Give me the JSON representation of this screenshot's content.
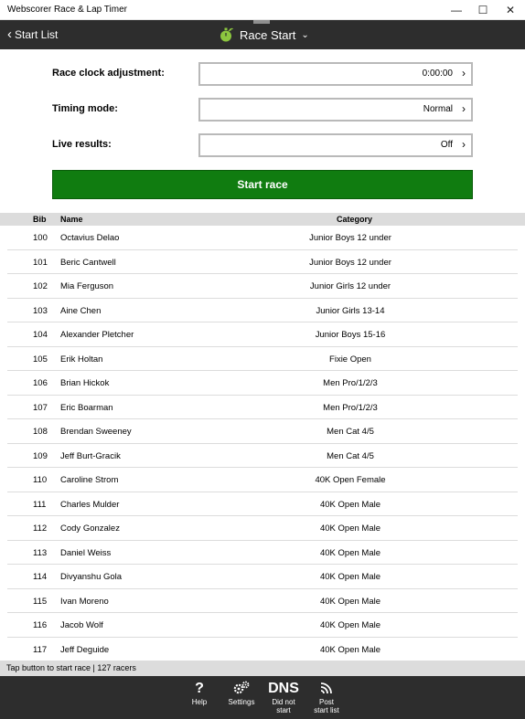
{
  "window": {
    "title": "Webscorer Race & Lap Timer",
    "minimize_glyph": "—",
    "maximize_glyph": "☐",
    "close_glyph": "✕"
  },
  "header": {
    "back_label": "Start List",
    "back_icon": "chevron-left-icon",
    "title": "Race Start",
    "logo_icon": "stopwatch-icon",
    "dropdown_icon": "chevron-down-icon"
  },
  "form": {
    "clock_label": "Race clock adjustment:",
    "clock_value": "0:00:00",
    "timing_label": "Timing mode:",
    "timing_value": "Normal",
    "live_label": "Live results:",
    "live_value": "Off"
  },
  "start_button": "Start race",
  "table": {
    "headers": {
      "bib": "Bib",
      "name": "Name",
      "category": "Category"
    },
    "rows": [
      {
        "bib": "100",
        "name": "Octavius Delao",
        "category": "Junior Boys 12 under"
      },
      {
        "bib": "101",
        "name": "Beric Cantwell",
        "category": "Junior Boys 12 under"
      },
      {
        "bib": "102",
        "name": "Mia Ferguson",
        "category": "Junior Girls 12 under"
      },
      {
        "bib": "103",
        "name": "Aine Chen",
        "category": "Junior Girls 13-14"
      },
      {
        "bib": "104",
        "name": "Alexander Pletcher",
        "category": "Junior Boys 15-16"
      },
      {
        "bib": "105",
        "name": "Erik Holtan",
        "category": "Fixie Open"
      },
      {
        "bib": "106",
        "name": "Brian Hickok",
        "category": "Men Pro/1/2/3"
      },
      {
        "bib": "107",
        "name": "Eric Boarman",
        "category": "Men Pro/1/2/3"
      },
      {
        "bib": "108",
        "name": "Brendan Sweeney",
        "category": "Men Cat 4/5"
      },
      {
        "bib": "109",
        "name": "Jeff Burt-Gracik",
        "category": "Men Cat 4/5"
      },
      {
        "bib": "110",
        "name": "Caroline Strom",
        "category": "40K Open Female"
      },
      {
        "bib": "111",
        "name": "Charles Mulder",
        "category": "40K Open Male"
      },
      {
        "bib": "112",
        "name": "Cody Gonzalez",
        "category": "40K Open Male"
      },
      {
        "bib": "113",
        "name": "Daniel Weiss",
        "category": "40K Open Male"
      },
      {
        "bib": "114",
        "name": "Divyanshu Gola",
        "category": "40K Open Male"
      },
      {
        "bib": "115",
        "name": "Ivan Moreno",
        "category": "40K Open Male"
      },
      {
        "bib": "116",
        "name": "Jacob Wolf",
        "category": "40K Open Male"
      },
      {
        "bib": "117",
        "name": "Jeff Deguide",
        "category": "40K Open Male"
      }
    ]
  },
  "status": "Tap button to start race | 127 racers",
  "bottom_bar": {
    "help_label": "Help",
    "settings_label": "Settings",
    "dns_icon_text": "DNS",
    "dns_label_1": "Did not",
    "dns_label_2": "start",
    "post_label_1": "Post",
    "post_label_2": "start list"
  },
  "colors": {
    "accent_green": "#107c10",
    "header_bg": "#2d2d2d",
    "logo_green": "#8cc63f"
  }
}
